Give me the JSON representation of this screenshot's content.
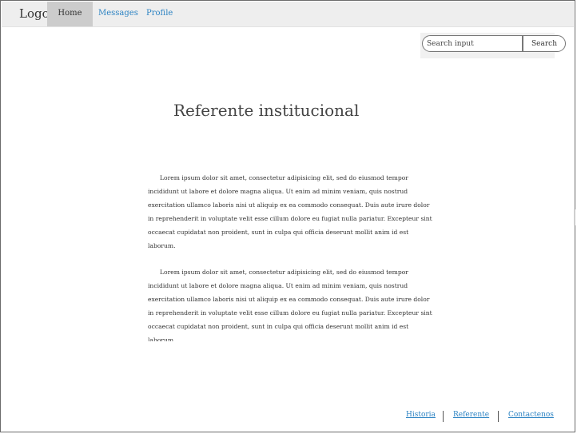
{
  "nav": {
    "logo": "Logo",
    "items": [
      {
        "label": "Home",
        "active": true
      },
      {
        "label": "Messages",
        "active": false
      },
      {
        "label": "Profile",
        "active": false
      }
    ]
  },
  "search": {
    "placeholder": "Search input",
    "button_label": "Search"
  },
  "main": {
    "title": "Referente institucional",
    "paragraphs": [
      "Lorem ipsum dolor sit amet, consectetur adipisicing elit, sed do eiusmod tempor incididunt ut labore et dolore magna aliqua. Ut enim ad minim veniam, quis nostrud exercitation ullamco laboris nisi ut aliquip ex ea commodo consequat. Duis aute irure dolor in reprehenderit in voluptate velit esse cillum dolore eu fugiat nulla pariatur. Excepteur sint occaecat cupidatat non proident, sunt in culpa qui officia deserunt mollit anim id est laborum.",
      "Lorem ipsum dolor sit amet, consectetur adipisicing elit, sed do eiusmod tempor incididunt ut labore et dolore magna aliqua. Ut enim ad minim veniam, quis nostrud exercitation ullamco laboris nisi ut aliquip ex ea commodo consequat. Duis aute irure dolor in reprehenderit in voluptate velit esse cillum dolore eu fugiat nulla pariatur. Excepteur sint occaecat cupidatat non proident, sunt in culpa qui officia deserunt mollit anim id est laborum."
    ]
  },
  "footer": {
    "links": [
      "Historia",
      "Referente",
      "Contactenos"
    ]
  },
  "colors": {
    "link": "#2c83c3",
    "nav_bg": "#eeeeee",
    "nav_active_bg": "#cccccc",
    "text": "#333333"
  }
}
